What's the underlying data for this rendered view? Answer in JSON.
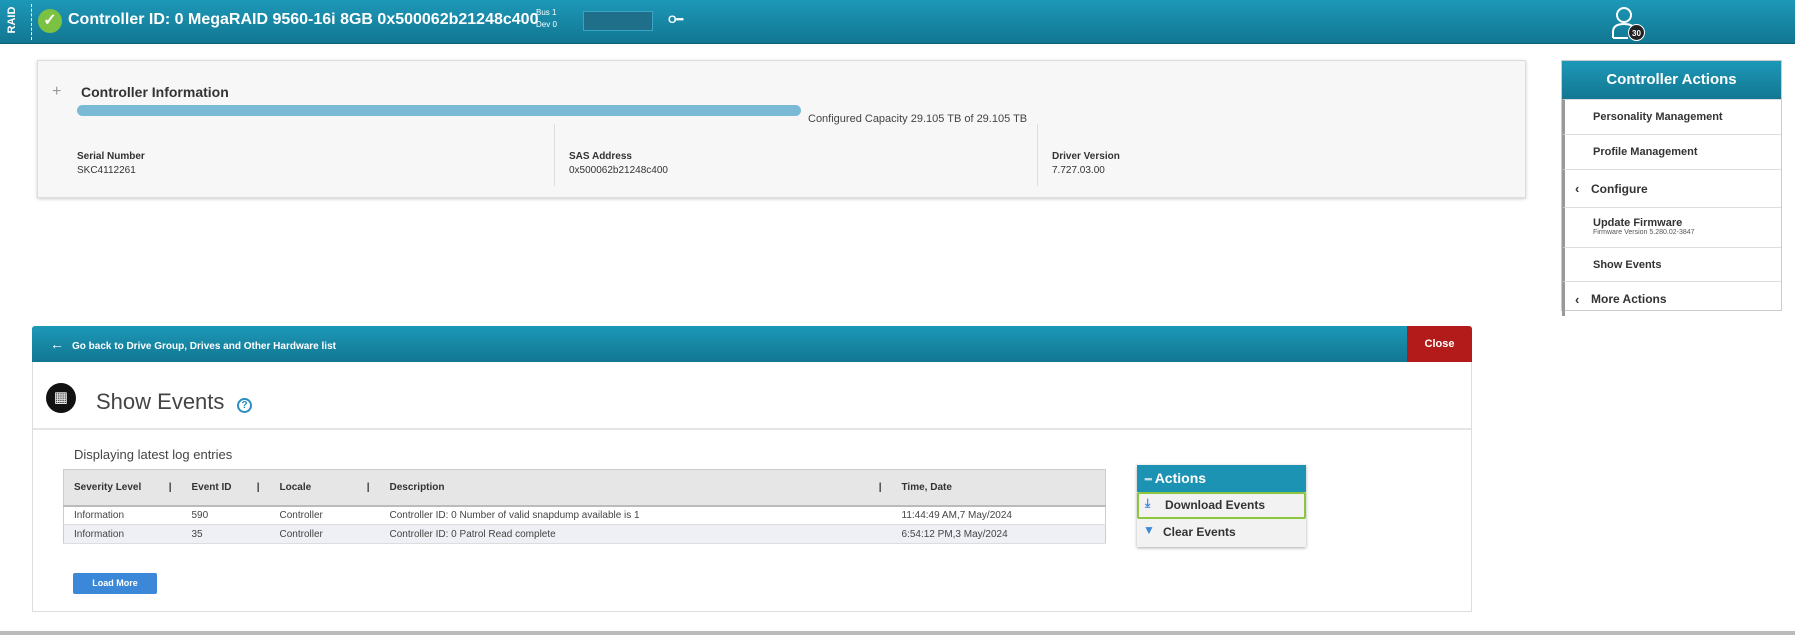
{
  "header": {
    "raid_label": "RAID",
    "controller_title": "Controller ID: 0 MegaRAID 9560-16i 8GB 0x500062b21248c400",
    "bus": "Bus 1",
    "dev": "Dev 0",
    "key_icon": "key-icon",
    "user_badge": "30"
  },
  "controller_info": {
    "title": "Controller Information",
    "capacity_text": "Configured Capacity 29.105 TB of 29.105 TB",
    "capacity_fraction": 1.0,
    "fields": [
      {
        "label": "Serial Number",
        "value": "SKC4112261"
      },
      {
        "label": "SAS Address",
        "value": "0x500062b21248c400"
      },
      {
        "label": "Driver Version",
        "value": "7.727.03.00"
      }
    ]
  },
  "controller_actions": {
    "title": "Controller Actions",
    "items": [
      {
        "label": "Personality Management"
      },
      {
        "label": "Profile Management"
      },
      {
        "label": "Configure"
      },
      {
        "label": "Update Firmware",
        "sub": "Firmware Version 5.280.02-3847"
      },
      {
        "label": "Show Events"
      },
      {
        "label": "More Actions"
      }
    ]
  },
  "events_panel": {
    "back_label": "Go back to Drive Group, Drives and Other Hardware list",
    "close_label": "Close",
    "title": "Show Events",
    "help": "?",
    "subtitle": "Displaying latest log entries",
    "columns": [
      "Severity Level",
      "Event ID",
      "Locale",
      "Description",
      "Time, Date"
    ],
    "rows": [
      [
        "Information",
        "590",
        "Controller",
        "Controller ID: 0 Number of valid snapdump available is 1",
        "11:44:49 AM,7 May/2024"
      ],
      [
        "Information",
        "35",
        "Controller",
        "Controller ID: 0 Patrol Read complete",
        "6:54:12 PM,3 May/2024"
      ]
    ],
    "load_more": "Load More",
    "actions": {
      "title": "Actions",
      "download": "Download Events",
      "clear": "Clear Events"
    }
  },
  "colors": {
    "header": "#1a8fae",
    "close": "#b31b1b",
    "bar": "#7bbad4",
    "highlight": "#8cc63f"
  }
}
